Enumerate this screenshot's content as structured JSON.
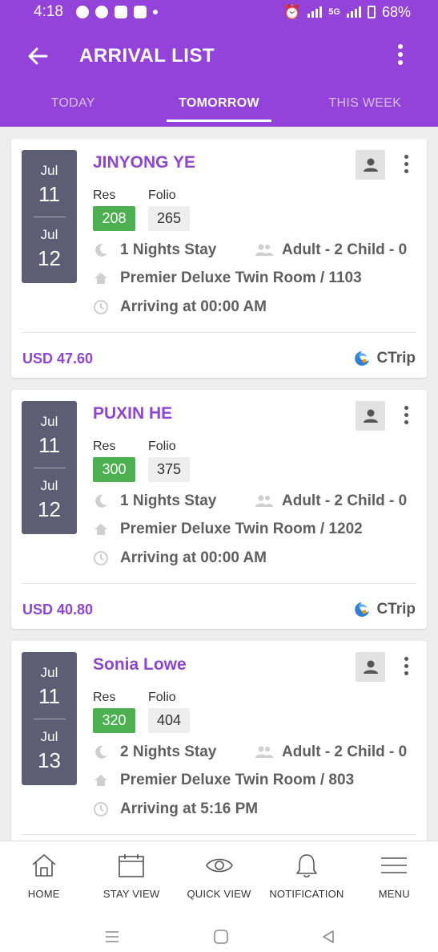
{
  "status_bar": {
    "time": "4:18",
    "network": "5G",
    "battery": "68%"
  },
  "app_bar": {
    "title": "ARRIVAL LIST",
    "tabs": [
      {
        "label": "TODAY",
        "active": false
      },
      {
        "label": "TOMORROW",
        "active": true
      },
      {
        "label": "THIS WEEK",
        "active": false
      }
    ]
  },
  "labels": {
    "res": "Res",
    "folio": "Folio"
  },
  "arrivals": [
    {
      "check_in_month": "Jul",
      "check_in_day": "11",
      "check_out_month": "Jul",
      "check_out_day": "12",
      "guest": "JINYONG YE",
      "res_no": "208",
      "folio_no": "265",
      "stay": "1 Nights Stay",
      "occupancy": "Adult - 2 Child - 0",
      "room": "Premier Deluxe Twin Room / 1103",
      "arrival": "Arriving at 00:00 AM",
      "amount": "USD 47.60",
      "source": "CTrip"
    },
    {
      "check_in_month": "Jul",
      "check_in_day": "11",
      "check_out_month": "Jul",
      "check_out_day": "12",
      "guest": "PUXIN HE",
      "res_no": "300",
      "folio_no": "375",
      "stay": "1 Nights Stay",
      "occupancy": "Adult - 2 Child - 0",
      "room": "Premier Deluxe Twin Room / 1202",
      "arrival": "Arriving at 00:00 AM",
      "amount": "USD 40.80",
      "source": "CTrip"
    },
    {
      "check_in_month": "Jul",
      "check_in_day": "11",
      "check_out_month": "Jul",
      "check_out_day": "13",
      "guest": "Sonia Lowe",
      "res_no": "320",
      "folio_no": "404",
      "stay": "2 Nights Stay",
      "occupancy": "Adult - 2 Child - 0",
      "room": "Premier Deluxe Twin Room / 803",
      "arrival": "Arriving at 5:16 PM",
      "amount": "",
      "source": ""
    }
  ],
  "bottom_nav": [
    {
      "label": "HOME",
      "icon": "home-icon"
    },
    {
      "label": "STAY VIEW",
      "icon": "calendar-icon"
    },
    {
      "label": "QUICK VIEW",
      "icon": "eye-icon"
    },
    {
      "label": "NOTIFICATION",
      "icon": "bell-icon"
    },
    {
      "label": "MENU",
      "icon": "hamburger-icon"
    }
  ],
  "colors": {
    "brand": "#9343da",
    "name": "#8e44d6",
    "res_badge": "#4caf50",
    "date_box": "#5d5e73"
  }
}
